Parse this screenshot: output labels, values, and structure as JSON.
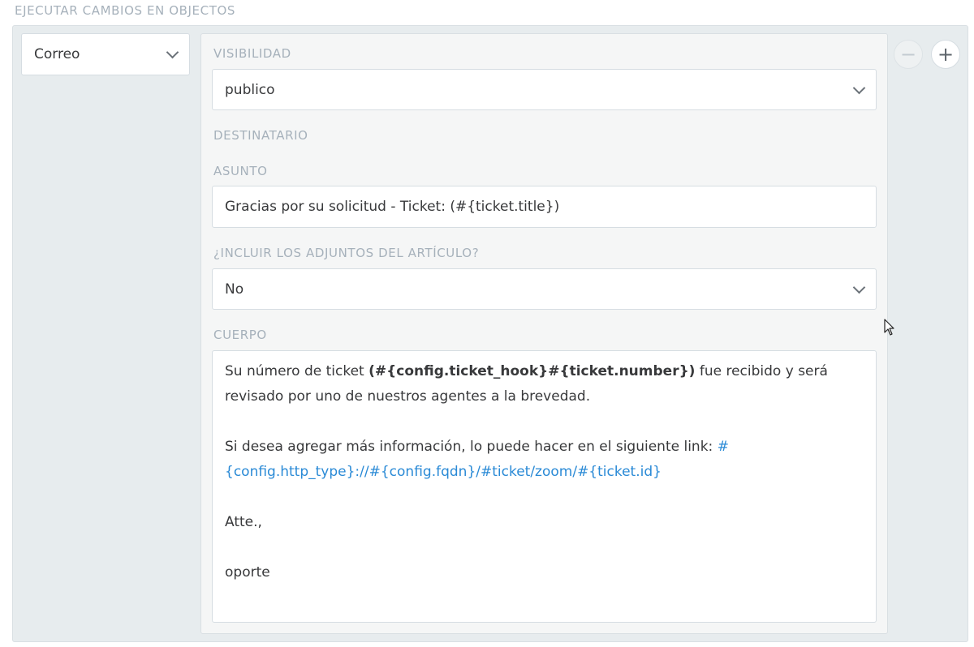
{
  "section_title": "EJECUTAR CAMBIOS EN OBJECTOS",
  "action": {
    "selected": "Correo"
  },
  "fields": {
    "visibility": {
      "label": "VISIBILIDAD",
      "value": "publico"
    },
    "recipient": {
      "label": "DESTINATARIO"
    },
    "subject": {
      "label": "ASUNTO",
      "value": "Gracias por su solicitud - Ticket: (#{ticket.title})"
    },
    "attachments": {
      "label": "¿INCLUIR LOS ADJUNTOS DEL ARTÍCULO?",
      "value": "No"
    },
    "body": {
      "label": "CUERPO",
      "line1_prefix": "Su número de ticket ",
      "line1_bold": "(#{config.ticket_hook}#{ticket.number})",
      "line1_suffix": " fue recibido y será revisado por uno de nuestros agentes a la brevedad.",
      "line2_prefix": "Si desea agregar más información, lo puede hacer en el siguiente link: ",
      "line2_link": "#{config.http_type}://#{config.fqdn}/#ticket/zoom/#{ticket.id}",
      "closing": "Atte.,",
      "signature": "oporte"
    }
  },
  "buttons": {
    "remove": "−",
    "add": "+"
  },
  "colors": {
    "link": "#2a8ad6",
    "label": "#a6b1bb",
    "panel_bg": "#e7ecee"
  },
  "icons": {
    "dropdown": "chevron-down-icon",
    "cursor": "mouse-pointer-icon"
  }
}
